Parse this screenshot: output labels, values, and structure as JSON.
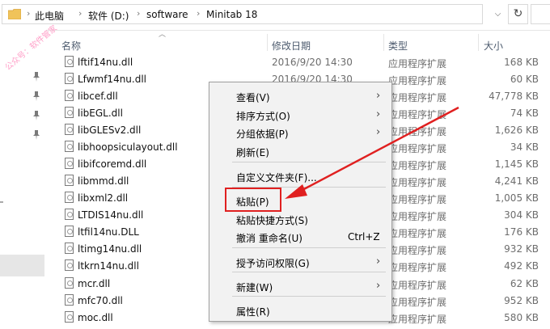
{
  "address": {
    "crumbs": [
      "此电脑",
      "软件 (D:)",
      "software",
      "Minitab 18"
    ],
    "separator": "›",
    "refresh_glyph": "↻",
    "dropdown_glyph": "⌵",
    "folder_icon_color": "#e8b84a"
  },
  "watermark": "公众号：软件管家",
  "columns": {
    "name": "名称",
    "date": "修改日期",
    "type": "类型",
    "size": "大小"
  },
  "files": [
    {
      "name": "lftif14nu.dll",
      "date": "2016/9/20 14:30",
      "type": "应用程序扩展",
      "size": "168 KB"
    },
    {
      "name": "Lfwmf14nu.dll",
      "date": "2016/9/20 14:30",
      "type": "应用程序扩展",
      "size": "60 KB"
    },
    {
      "name": "libcef.dll",
      "date": "",
      "type": "应用程序扩展",
      "size": "47,778 KB"
    },
    {
      "name": "libEGL.dll",
      "date": "",
      "type": "应用程序扩展",
      "size": "74 KB"
    },
    {
      "name": "libGLESv2.dll",
      "date": "",
      "type": "应用程序扩展",
      "size": "1,626 KB"
    },
    {
      "name": "libhoopsiculayout.dll",
      "date": "",
      "type": "应用程序扩展",
      "size": "34 KB"
    },
    {
      "name": "libifcoremd.dll",
      "date": "",
      "type": "应用程序扩展",
      "size": "1,145 KB"
    },
    {
      "name": "libmmd.dll",
      "date": "",
      "type": "应用程序扩展",
      "size": "4,241 KB"
    },
    {
      "name": "libxml2.dll",
      "date": "",
      "type": "应用程序扩展",
      "size": "1,005 KB"
    },
    {
      "name": "LTDIS14nu.dll",
      "date": "",
      "type": "应用程序扩展",
      "size": "304 KB"
    },
    {
      "name": "ltfil14nu.DLL",
      "date": "",
      "type": "应用程序扩展",
      "size": "176 KB"
    },
    {
      "name": "ltimg14nu.dll",
      "date": "",
      "type": "应用程序扩展",
      "size": "932 KB"
    },
    {
      "name": "ltkrn14nu.dll",
      "date": "",
      "type": "应用程序扩展",
      "size": "492 KB"
    },
    {
      "name": "mcr.dll",
      "date": "",
      "type": "应用程序扩展",
      "size": "62 KB"
    },
    {
      "name": "mfc70.dll",
      "date": "",
      "type": "应用程序扩展",
      "size": "952 KB"
    },
    {
      "name": "moc.dll",
      "date": "",
      "type": "应用程序扩展",
      "size": "580 KB"
    }
  ],
  "context_menu": [
    {
      "label": "查看(V)",
      "submenu": true
    },
    {
      "label": "排序方式(O)",
      "submenu": true
    },
    {
      "label": "分组依据(P)",
      "submenu": true
    },
    {
      "label": "刷新(E)",
      "submenu": false
    },
    {
      "label": "自定义文件夹(F)...",
      "submenu": false
    },
    {
      "label": "粘贴(P)",
      "submenu": false
    },
    {
      "label": "粘贴快捷方式(S)",
      "submenu": false
    },
    {
      "label": "撤消 重命名(U)",
      "submenu": false,
      "shortcut": "Ctrl+Z"
    },
    {
      "label": "授予访问权限(G)",
      "submenu": true
    },
    {
      "label": "新建(W)",
      "submenu": true
    },
    {
      "label": "属性(R)",
      "submenu": false
    }
  ],
  "colors": {
    "highlight_box": "#e02020",
    "arrow": "#e02020",
    "menu_bg": "#f2f2f2"
  }
}
